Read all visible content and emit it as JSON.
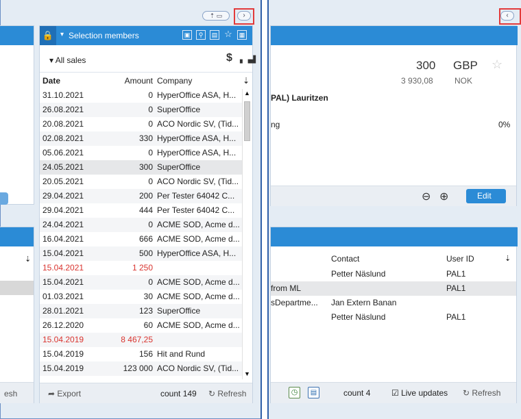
{
  "top_controls": {
    "pin_label": "⇡ ▭",
    "left_collapse": "›",
    "right_collapse": "‹"
  },
  "selection": {
    "title": "Selection members",
    "title_caret": "▾",
    "lock_icon": "🔒",
    "filter_label": "▾ All sales",
    "currency_icon": "$",
    "chart_icon": "▖▗▟",
    "columns": {
      "date": "Date",
      "amount": "Amount",
      "company": "Company",
      "sort": "⇣"
    },
    "rows": [
      {
        "date": "31.10.2021",
        "amount": "0",
        "company": "HyperOffice ASA, H...",
        "style": ""
      },
      {
        "date": "26.08.2021",
        "amount": "0",
        "company": "SuperOffice",
        "style": "alt"
      },
      {
        "date": "20.08.2021",
        "amount": "0",
        "company": "ACO Nordic SV, (Tid...",
        "style": ""
      },
      {
        "date": "02.08.2021",
        "amount": "330",
        "company": "HyperOffice ASA, H...",
        "style": "alt"
      },
      {
        "date": "05.06.2021",
        "amount": "0",
        "company": "HyperOffice ASA, H...",
        "style": ""
      },
      {
        "date": "24.05.2021",
        "amount": "300",
        "company": "SuperOffice",
        "style": "sel"
      },
      {
        "date": "20.05.2021",
        "amount": "0",
        "company": "ACO Nordic SV, (Tid...",
        "style": ""
      },
      {
        "date": "29.04.2021",
        "amount": "200",
        "company": "Per Tester 64042 C...",
        "style": "alt"
      },
      {
        "date": "29.04.2021",
        "amount": "444",
        "company": "Per Tester 64042 C...",
        "style": ""
      },
      {
        "date": "24.04.2021",
        "amount": "0",
        "company": "ACME SOD, Acme d...",
        "style": "alt"
      },
      {
        "date": "16.04.2021",
        "amount": "666",
        "company": "ACME SOD, Acme d...",
        "style": ""
      },
      {
        "date": "15.04.2021",
        "amount": "500",
        "company": "HyperOffice ASA, H...",
        "style": "alt"
      },
      {
        "date": "15.04.2021",
        "amount": "1 250",
        "company": "",
        "style": "red"
      },
      {
        "date": "15.04.2021",
        "amount": "0",
        "company": "ACME SOD, Acme d...",
        "style": "alt"
      },
      {
        "date": "01.03.2021",
        "amount": "30",
        "company": "ACME SOD, Acme d...",
        "style": ""
      },
      {
        "date": "28.01.2021",
        "amount": "123",
        "company": "SuperOffice",
        "style": "alt"
      },
      {
        "date": "26.12.2020",
        "amount": "60",
        "company": "ACME SOD, Acme d...",
        "style": ""
      },
      {
        "date": "15.04.2019",
        "amount": "8 467,25",
        "company": "",
        "style": "alt red"
      },
      {
        "date": "15.04.2019",
        "amount": "156",
        "company": "Hit and Rund",
        "style": ""
      },
      {
        "date": "15.04.2019",
        "amount": "123 000",
        "company": "ACO Nordic SV, (Tid...",
        "style": "alt"
      }
    ],
    "footer": {
      "export": "Export",
      "count": "count 149",
      "refresh": "Refresh"
    }
  },
  "left_partial": {
    "refresh_fragment": "esh",
    "sort": "⇣"
  },
  "sale_card": {
    "amount": "300",
    "currency": "GBP",
    "nok_amount": "3 930,08",
    "nok_currency": "NOK",
    "owner_fragment": "PAL) Lauritzen",
    "text_fragment": "ng",
    "percent": "0%",
    "edit_label": "Edit"
  },
  "related": {
    "columns": {
      "contact": "Contact",
      "user_id": "User ID",
      "sort": "⇣"
    },
    "rows": [
      {
        "col1": "",
        "contact": "Petter Näslund",
        "user_id": "PAL1",
        "style": ""
      },
      {
        "col1": "from ML",
        "contact": "",
        "user_id": "PAL1",
        "style": "gray"
      },
      {
        "col1": "sDepartme...",
        "contact": "Jan Extern Banan",
        "user_id": "",
        "style": ""
      },
      {
        "col1": "",
        "contact": "Petter Näslund",
        "user_id": "PAL1",
        "style": ""
      }
    ],
    "footer": {
      "count": "count 4",
      "live_updates": "Live updates",
      "refresh": "Refresh"
    }
  }
}
